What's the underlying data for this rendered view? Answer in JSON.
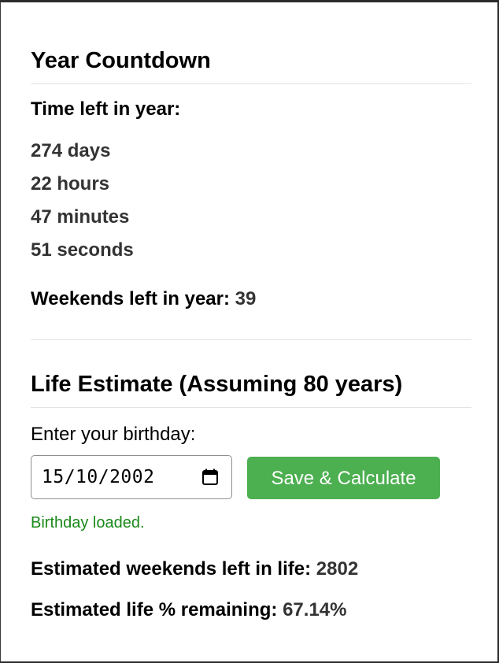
{
  "year_countdown": {
    "heading": "Year Countdown",
    "time_left_label": "Time left in year:",
    "days": "274 days",
    "hours": "22 hours",
    "minutes": "47 minutes",
    "seconds": "51 seconds",
    "weekends_label": "Weekends left in year:",
    "weekends_value": "39"
  },
  "life_estimate": {
    "heading": "Life Estimate (Assuming 80 years)",
    "birthday_label": "Enter your birthday:",
    "birthday_value": "15/10/2002",
    "save_button_label": "Save & Calculate",
    "status_message": "Birthday loaded.",
    "weekends_label": "Estimated weekends left in life:",
    "weekends_value": "2802",
    "life_pct_label": "Estimated life % remaining:",
    "life_pct_value": "67.14%"
  },
  "icons": {
    "date_picker": "calendar-icon"
  },
  "colors": {
    "save_button": "#4caf50",
    "status_message": "#1a8a1a"
  }
}
